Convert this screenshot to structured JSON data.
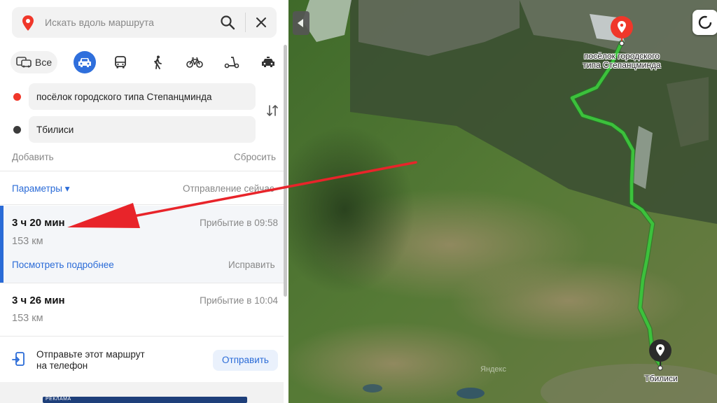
{
  "search": {
    "placeholder": "Искать вдоль маршрута"
  },
  "modes": {
    "all_label": "Все",
    "items": [
      "car-icon",
      "bus-icon",
      "walk-icon",
      "bicycle-icon",
      "scooter-icon",
      "taxi-icon"
    ],
    "active": "car-icon"
  },
  "route": {
    "from": "посёлок городского типа Степанцминда",
    "to": "Тбилиси",
    "add_label": "Добавить",
    "reset_label": "Сбросить"
  },
  "params": {
    "label": "Параметры ▾",
    "departure": "Отправление сейчас"
  },
  "options": [
    {
      "time": "3 ч 20 мин",
      "arrival": "Прибытие в 09:58",
      "distance": "153 км",
      "details_label": "Посмотреть подробнее",
      "fix_label": "Исправить"
    },
    {
      "time": "3 ч 26 мин",
      "arrival": "Прибытие в 10:04",
      "distance": "153 км"
    }
  ],
  "send": {
    "text_line1": "Отправьте этот маршрут",
    "text_line2": "на телефон",
    "button": "Отправить"
  },
  "ad": {
    "label": "РЕКЛАМА"
  },
  "map": {
    "start_label_line1": "посёлок городского",
    "start_label_line2": "типа Степанцминда",
    "end_label": "Тбилиси",
    "watermark": "Яндекс"
  },
  "colors": {
    "accent": "#2a6bd7",
    "route": "#3cc13c",
    "start_pin": "#f0372a",
    "end_pin": "#2b2b2b",
    "annotation_arrow": "#e8242a"
  }
}
